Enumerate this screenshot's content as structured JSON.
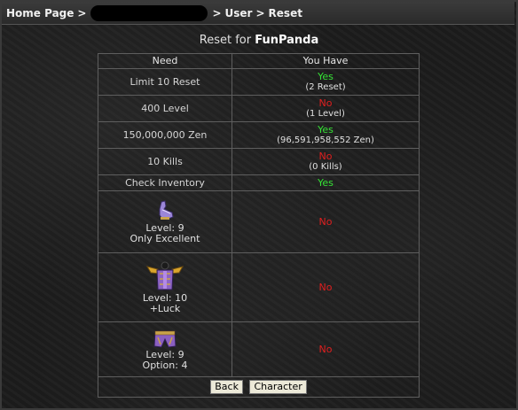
{
  "breadcrumb": {
    "home": "Home Page",
    "sep1": ">",
    "sep2": ">",
    "user": "User",
    "sep3": ">",
    "current": "Reset"
  },
  "title": {
    "prefix": "Reset for",
    "name": "FunPanda"
  },
  "table": {
    "headers": {
      "need": "Need",
      "have": "You Have"
    },
    "rows": [
      {
        "need": "Limit 10 Reset",
        "status": "Yes",
        "detail": "(2 Reset)"
      },
      {
        "need": "400 Level",
        "status": "No",
        "detail": "(1 Level)"
      },
      {
        "need": "150,000,000 Zen",
        "status": "Yes",
        "detail": "(96,591,958,552 Zen)"
      },
      {
        "need": "10 Kills",
        "status": "No",
        "detail": "(0 Kills)"
      },
      {
        "need": "Check Inventory",
        "status": "Yes"
      }
    ],
    "items": [
      {
        "icon": "gloves-icon",
        "level": "Level: 9",
        "extra": "Only Excellent",
        "status": "No"
      },
      {
        "icon": "winged-armor-icon",
        "level": "Level: 10",
        "extra": "+Luck",
        "status": "No"
      },
      {
        "icon": "pants-icon",
        "level": "Level: 9",
        "extra": "Option: 4",
        "status": "No"
      }
    ]
  },
  "buttons": {
    "back": "Back",
    "character": "Character"
  },
  "colors": {
    "yes": "#35e235",
    "no": "#e01f1f",
    "background": "#1c1c1c"
  }
}
